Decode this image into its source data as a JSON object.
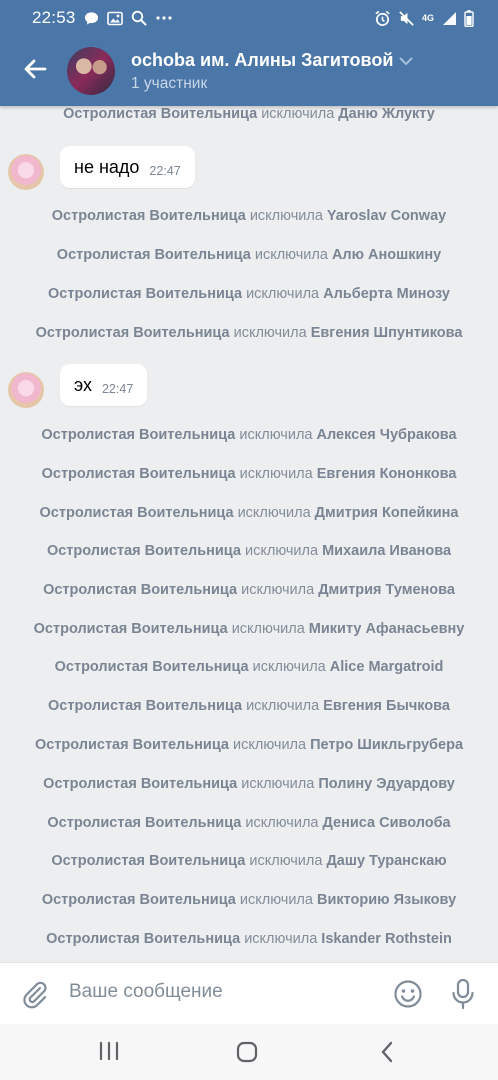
{
  "status": {
    "time": "22:53",
    "network": "4G"
  },
  "header": {
    "title": "ochoba им. Алины Загитовой",
    "subtitle": "1 участник"
  },
  "events": [
    {
      "actor": "Остролистая Воительница",
      "verb": "исключила",
      "target": "Даню Жлукту"
    },
    {
      "actor": "Остролистая Воительница",
      "verb": "исключила",
      "target": "Yaroslav Conway"
    },
    {
      "actor": "Остролистая Воительница",
      "verb": "исключила",
      "target": "Алю Аношкину"
    },
    {
      "actor": "Остролистая Воительница",
      "verb": "исключила",
      "target": "Альберта Минозу"
    },
    {
      "actor": "Остролистая Воительница",
      "verb": "исключила",
      "target": "Евгения Шпунтикова"
    },
    {
      "actor": "Остролистая Воительница",
      "verb": "исключила",
      "target": "Алексея Чубракова"
    },
    {
      "actor": "Остролистая Воительница",
      "verb": "исключила",
      "target": "Евгения Кононкова"
    },
    {
      "actor": "Остролистая Воительница",
      "verb": "исключила",
      "target": "Дмитрия Копейкина"
    },
    {
      "actor": "Остролистая Воительница",
      "verb": "исключила",
      "target": "Михаила Иванова"
    },
    {
      "actor": "Остролистая Воительница",
      "verb": "исключила",
      "target": "Дмитрия Туменова"
    },
    {
      "actor": "Остролистая Воительница",
      "verb": "исключила",
      "target": "Микиту Афанасьевну"
    },
    {
      "actor": "Остролистая Воительница",
      "verb": "исключила",
      "target": "Alice Margatroid"
    },
    {
      "actor": "Остролистая Воительница",
      "verb": "исключила",
      "target": "Евгения Бычкова"
    },
    {
      "actor": "Остролистая Воительница",
      "verb": "исключила",
      "target": "Петро Шикльгрубера"
    },
    {
      "actor": "Остролистая Воительница",
      "verb": "исключила",
      "target": "Полину Эдуардову"
    },
    {
      "actor": "Остролистая Воительница",
      "verb": "исключила",
      "target": "Дениса Сиволоба"
    },
    {
      "actor": "Остролистая Воительница",
      "verb": "исключила",
      "target": "Дашу Туранскаю"
    },
    {
      "actor": "Остролистая Воительница",
      "verb": "исключила",
      "target": "Викторию Языкову"
    },
    {
      "actor": "Остролистая Воительница",
      "verb": "исключила",
      "target": "Iskander Rothstein"
    }
  ],
  "messages": [
    {
      "text": "не надо",
      "time": "22:47"
    },
    {
      "text": "эх",
      "time": "22:47"
    }
  ],
  "composer": {
    "placeholder": "Ваше сообщение"
  },
  "colors": {
    "header": "#4a76a8",
    "background": "#edeef0",
    "service_text": "#828d9a"
  },
  "icons": [
    "back-arrow-icon",
    "chevron-down-icon",
    "attach-icon",
    "emoji-icon",
    "microphone-icon",
    "recent-apps-icon",
    "home-icon",
    "nav-back-icon"
  ]
}
